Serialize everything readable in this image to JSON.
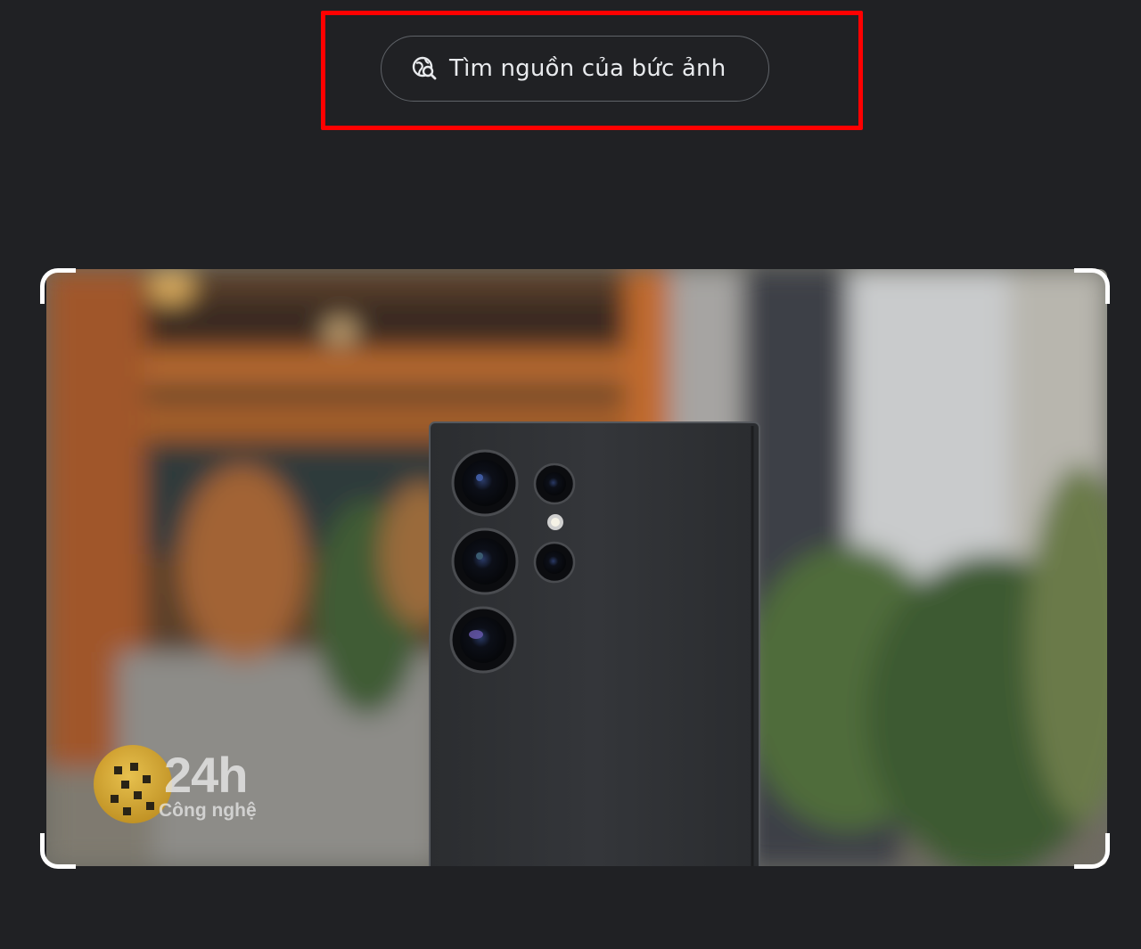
{
  "lens": {
    "source_button_label": "Tìm nguồn của bức ảnh",
    "source_button_icon": "image-search-icon"
  },
  "image": {
    "watermark_number": "24h",
    "watermark_subtitle": "Công nghệ"
  },
  "colors": {
    "background": "#202124",
    "highlight": "#ff0000",
    "button_border": "#5f6368",
    "button_text": "#e8eaed"
  }
}
